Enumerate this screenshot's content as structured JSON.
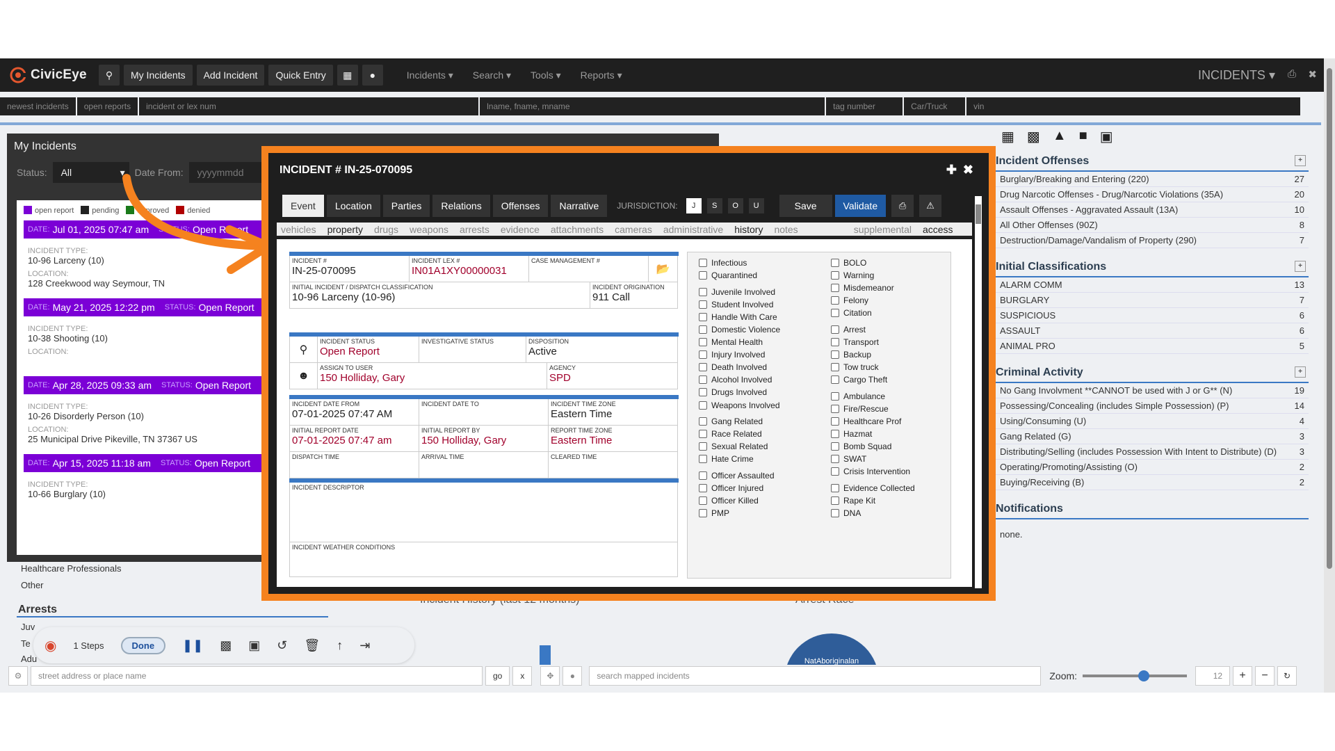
{
  "topbar": {
    "app_name": "CivicEye",
    "my_incidents": "My Incidents",
    "add_incident": "Add Incident",
    "quick_entry": "Quick Entry",
    "menus": [
      "Incidents",
      "Search",
      "Tools",
      "Reports"
    ],
    "section": "INCIDENTS"
  },
  "searchbar": {
    "newest": "newest incidents",
    "open_reports": "open reports",
    "incident_num": "incident or lex num",
    "name": "lname, fname, mname",
    "tag": "tag number",
    "vehicle": "Car/Truck",
    "vin": "vin"
  },
  "my_incidents": {
    "title": "My Incidents",
    "status_label": "Status:",
    "status_value": "All",
    "date_from_label": "Date From:",
    "date_placeholder": "yyyymmdd",
    "legend": [
      "open report",
      "pending",
      "approved",
      "denied"
    ],
    "legend_colors": [
      "#7b00d6",
      "#222",
      "#1a7a1a",
      "#b00000"
    ],
    "items": [
      {
        "date_label": "DATE:",
        "date": "Jul 01, 2025 07:47 am",
        "status_label": "STATUS:",
        "status": "Open Report",
        "type_label": "INCIDENT TYPE:",
        "type": "10-96 Larceny (10)",
        "loc_label": "LOCATION:",
        "location": "128 Creekwood way Seymour, TN"
      },
      {
        "date_label": "DATE:",
        "date": "May 21, 2025 12:22 pm",
        "status_label": "STATUS:",
        "status": "Open Report",
        "type_label": "INCIDENT TYPE:",
        "type": "10-38 Shooting (10)",
        "loc_label": "LOCATION:",
        "location": ""
      },
      {
        "date_label": "DATE:",
        "date": "Apr 28, 2025 09:33 am",
        "status_label": "STATUS:",
        "status": "Open Report",
        "type_label": "INCIDENT TYPE:",
        "type": "10-26 Disorderly Person (10)",
        "loc_label": "LOCATION:",
        "location": "25 Municipal Drive Pikeville, TN 37367 US"
      },
      {
        "date_label": "DATE:",
        "date": "Apr 15, 2025 11:18 am",
        "status_label": "STATUS:",
        "status": "Open Report",
        "type_label": "INCIDENT TYPE:",
        "type": "10-66 Burglary (10)",
        "loc_label": "",
        "location": ""
      }
    ]
  },
  "behind": {
    "healthcare": "Healthcare Professionals",
    "other": "Other",
    "arrests": "Arrests",
    "juv": "Juv",
    "te": "Te",
    "adu": "Adu",
    "history": "Incident History (last 12 months)",
    "race": "Arrest Race",
    "race_label": "NatAboriginalan"
  },
  "right_panel": {
    "offenses_title": "Incident Offenses",
    "offenses": [
      {
        "name": "Burglary/Breaking and Entering (220)",
        "count": "27"
      },
      {
        "name": "Drug Narcotic Offenses - Drug/Narcotic Violations (35A)",
        "count": "20"
      },
      {
        "name": "Assault Offenses - Aggravated Assault (13A)",
        "count": "10"
      },
      {
        "name": "All Other Offenses (90Z)",
        "count": "8"
      },
      {
        "name": "Destruction/Damage/Vandalism of Property (290)",
        "count": "7"
      }
    ],
    "classifications_title": "Initial Classifications",
    "classifications": [
      {
        "name": "ALARM COMM",
        "count": "13"
      },
      {
        "name": "BURGLARY",
        "count": "7"
      },
      {
        "name": "SUSPICIOUS",
        "count": "6"
      },
      {
        "name": "ASSAULT",
        "count": "6"
      },
      {
        "name": "ANIMAL PRO",
        "count": "5"
      }
    ],
    "criminal_title": "Criminal Activity",
    "criminal": [
      {
        "name": "No Gang Involvment **CANNOT be used with J or G** (N)",
        "count": "19"
      },
      {
        "name": "Possessing/Concealing (includes Simple Possession) (P)",
        "count": "14"
      },
      {
        "name": "Using/Consuming (U)",
        "count": "4"
      },
      {
        "name": "Gang Related (G)",
        "count": "3"
      },
      {
        "name": "Distributing/Selling (includes Possession With Intent to Distribute) (D)",
        "count": "3"
      },
      {
        "name": "Operating/Promoting/Assisting (O)",
        "count": "2"
      },
      {
        "name": "Buying/Receiving (B)",
        "count": "2"
      }
    ],
    "notifications_title": "Notifications",
    "notifications_value": "none."
  },
  "steps": {
    "count": "1 Steps",
    "done": "Done"
  },
  "bottombar": {
    "address_placeholder": "street address or place name",
    "go": "go",
    "x": "x",
    "search_placeholder": "search mapped incidents",
    "zoom_label": "Zoom:",
    "zoom_value": "12",
    "zoom_level": 0.6
  },
  "modal": {
    "title": "INCIDENT # IN-25-070095",
    "tabs": [
      "Event",
      "Location",
      "Parties",
      "Relations",
      "Offenses",
      "Narrative"
    ],
    "jurisdiction_label": "JURISDICTION:",
    "jurisdiction": [
      "J",
      "S",
      "O",
      "U"
    ],
    "save": "Save",
    "validate": "Validate",
    "subnav": [
      "vehicles",
      "property",
      "drugs",
      "weapons",
      "arrests",
      "evidence",
      "attachments",
      "cameras",
      "administrative",
      "history",
      "notes",
      "supplemental",
      "access"
    ],
    "f": {
      "incident_num_l": "INCIDENT #",
      "incident_num": "IN-25-070095",
      "lex_l": "INCIDENT LEX #",
      "lex": "IN01A1XY00000031",
      "case_l": "CASE MANAGEMENT #",
      "case": "",
      "class_l": "INITIAL INCIDENT / DISPATCH CLASSIFICATION",
      "class": "10-96 Larceny (10-96)",
      "orig_l": "INCIDENT ORIGINATION",
      "orig": "911 Call",
      "status_l": "INCIDENT STATUS",
      "status": "Open Report",
      "inv_l": "INVESTIGATIVE STATUS",
      "inv": "",
      "disp_l": "DISPOSITION",
      "disp": "Active",
      "assign_l": "ASSIGN TO USER",
      "assign": "150 Holliday, Gary",
      "agency_l": "AGENCY",
      "agency": "SPD",
      "date_from_l": "INCIDENT DATE FROM",
      "date_from": "07-01-2025 07:47 AM",
      "date_to_l": "INCIDENT DATE TO",
      "date_to": "",
      "tz_l": "INCIDENT TIME ZONE",
      "tz": "Eastern Time",
      "rep_date_l": "INITIAL REPORT DATE",
      "rep_date": "07-01-2025 07:47 am",
      "rep_by_l": "INITIAL REPORT BY",
      "rep_by": "150 Holliday, Gary",
      "rep_tz_l": "REPORT TIME ZONE",
      "rep_tz": "Eastern Time",
      "dispatch_l": "DISPATCH TIME",
      "arrival_l": "ARRIVAL TIME",
      "cleared_l": "CLEARED TIME",
      "descriptor_l": "INCIDENT DESCRIPTOR",
      "weather_l": "INCIDENT WEATHER CONDITIONS"
    },
    "checks_left": [
      "Infectious",
      "Quarantined",
      "Juvenile Involved",
      "Student Involved",
      "Handle With Care",
      "Domestic Violence",
      "Mental Health",
      "Injury Involved",
      "Death Involved",
      "Alcohol Involved",
      "Drugs Involved",
      "Weapons Involved",
      "Gang Related",
      "Race Related",
      "Sexual Related",
      "Hate Crime",
      "Officer Assaulted",
      "Officer Injured",
      "Officer Killed",
      "PMP"
    ],
    "checks_right": [
      "BOLO",
      "Warning",
      "Misdemeanor",
      "Felony",
      "Citation",
      "Arrest",
      "Transport",
      "Backup",
      "Tow truck",
      "Cargo Theft",
      "Ambulance",
      "Fire/Rescue",
      "Healthcare Prof",
      "Hazmat",
      "Bomb Squad",
      "SWAT",
      "Crisis Intervention",
      "Evidence Collected",
      "Rape Kit",
      "DNA"
    ]
  }
}
